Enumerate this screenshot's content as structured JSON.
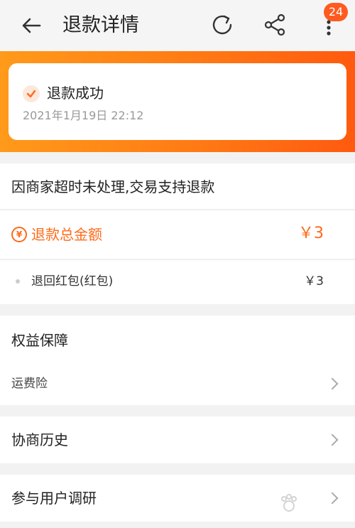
{
  "header": {
    "title": "退款详情",
    "badge_count": "24",
    "icons": [
      "back-arrow-icon",
      "refresh-icon",
      "share-icon",
      "more-icon"
    ]
  },
  "status": {
    "label": "退款成功",
    "time": "2021年1月19日 22:12"
  },
  "reason": "因商家超时未处理,交易支持退款",
  "refund": {
    "total_label": "退款总金额",
    "total_value": "￥3",
    "items": [
      {
        "label": "退回红包(红包)",
        "value": "￥3"
      }
    ]
  },
  "rights": {
    "title": "权益保障",
    "item": "运费险"
  },
  "history": "协商历史",
  "survey": "参与用户调研",
  "colors": {
    "accent": "#ff6a1a",
    "banner_start": "#ff9a1a",
    "banner_end": "#ff5a0f",
    "badge": "#ff5a1f"
  }
}
